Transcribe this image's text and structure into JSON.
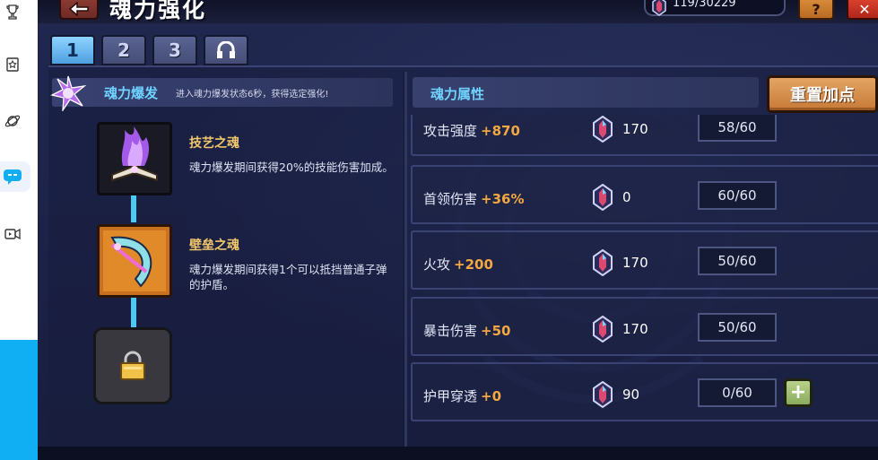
{
  "side_rail": {
    "icons": [
      "trophy-icon",
      "bookmark-icon",
      "planet-icon",
      "chat-icon",
      "video-icon"
    ]
  },
  "header": {
    "title": "魂力强化",
    "crystal_count": "119/30229",
    "help_label": "?",
    "close_label": "✕"
  },
  "tabs": [
    {
      "label": "1",
      "active": true
    },
    {
      "label": "2",
      "active": false
    },
    {
      "label": "3",
      "active": false
    },
    {
      "label": "",
      "icon": "headset-icon",
      "active": false
    }
  ],
  "soul_burst": {
    "title": "魂力爆发",
    "description": "进入魂力爆发状态6秒，获得选定强化!"
  },
  "skills": [
    {
      "name": "技艺之魂",
      "description": "魂力爆发期间获得20%的技能伤害加成。",
      "icon": "spellbook-flame-icon"
    },
    {
      "name": "壁垒之魂",
      "description": "魂力爆发期间获得1个可以抵挡普通子弹的护盾。",
      "icon": "shield-arc-icon"
    },
    {
      "name": "",
      "description": "",
      "icon": "lock-icon",
      "locked": true
    }
  ],
  "attributes": {
    "title": "魂力属性",
    "reset_label": "重置加点",
    "items": [
      {
        "name": "攻击强度",
        "bonus": "+870",
        "cost": "170",
        "level": "58/60"
      },
      {
        "name": "首领伤害",
        "bonus": "+36%",
        "cost": "0",
        "level": "60/60"
      },
      {
        "name": "火攻",
        "bonus": "+200",
        "cost": "170",
        "level": "50/60"
      },
      {
        "name": "暴击伤害",
        "bonus": "+50",
        "cost": "170",
        "level": "50/60"
      },
      {
        "name": "护甲穿透",
        "bonus": "+0",
        "cost": "90",
        "level": "0/60",
        "plus_label": "+"
      }
    ]
  },
  "colors": {
    "accent_blue": "#6fd2ff",
    "bonus_orange": "#f4a640",
    "skill_gold": "#f2c66b",
    "reset_orange": "#d08a45",
    "plus_green": "#9fbf72"
  }
}
